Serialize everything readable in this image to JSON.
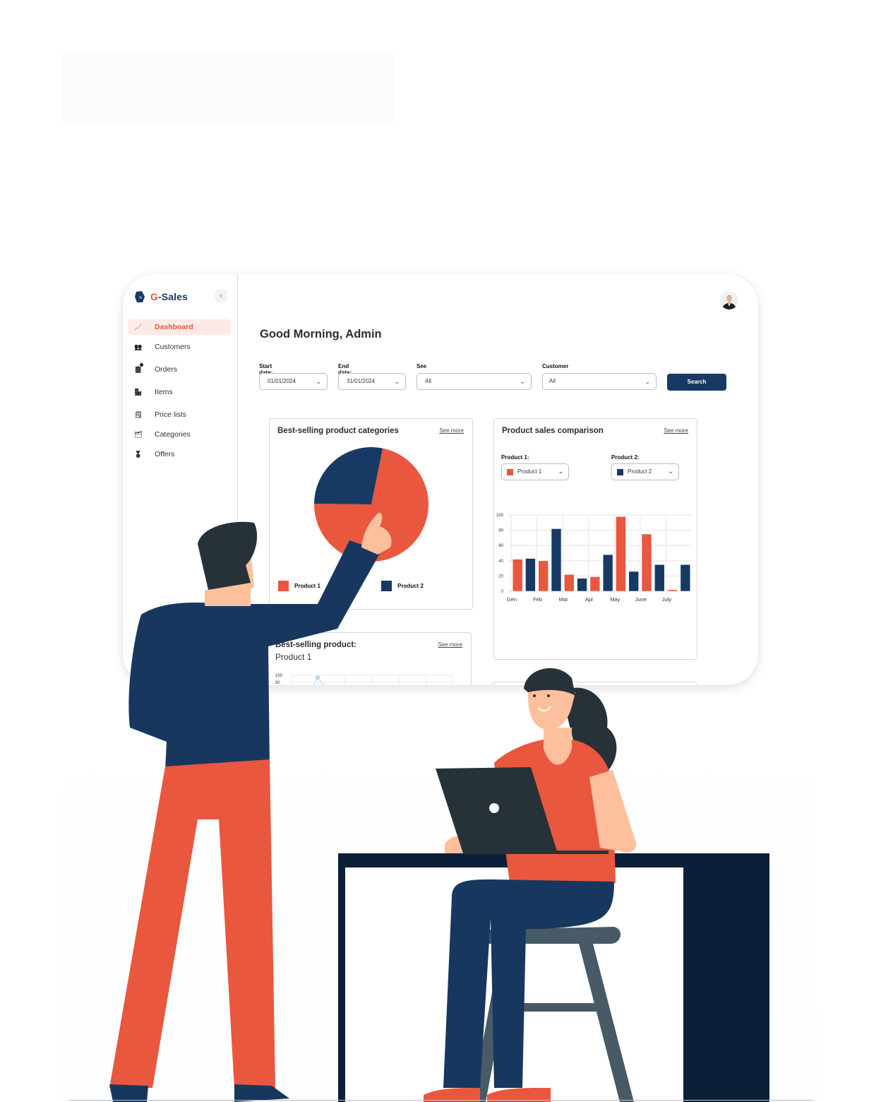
{
  "app": {
    "brand_prefix": "G",
    "brand_suffix": "-Sales",
    "collapse_icon": "chevron-left-icon",
    "collapse_glyph": "‹"
  },
  "sidebar": {
    "items": [
      {
        "label": "Dashboard",
        "icon": "chart-line-icon",
        "glyph": "📈",
        "active": true
      },
      {
        "label": "Customers",
        "icon": "users-icon",
        "glyph": "👥",
        "active": false
      },
      {
        "label": "Orders",
        "icon": "clipboard-icon",
        "glyph": "📋",
        "active": false,
        "notification": true
      },
      {
        "label": "Items",
        "icon": "store-icon",
        "glyph": "🏪",
        "active": false
      },
      {
        "label": "Price lists",
        "icon": "price-list-icon",
        "glyph": "🗒",
        "active": false
      },
      {
        "label": "Categories",
        "icon": "categories-icon",
        "glyph": "🗂",
        "active": false
      },
      {
        "label": "Offers",
        "icon": "award-icon",
        "glyph": "🏅",
        "active": false
      }
    ]
  },
  "header": {
    "greeting": "Good Morning, Admin",
    "avatar": "user-avatar"
  },
  "filters": {
    "start_date": {
      "label": "Start date:",
      "value": "01/01/2024"
    },
    "end_date": {
      "label": "End date:",
      "value": "31/01/2024"
    },
    "see": {
      "label": "See",
      "value": "All"
    },
    "customer": {
      "label": "Customer",
      "value": "All"
    },
    "search_label": "Search",
    "chevron": "⌄"
  },
  "cards": {
    "categories": {
      "title": "Best-selling product categories",
      "see_more": "See more"
    },
    "comparison": {
      "title": "Product sales comparison",
      "see_more": "See more",
      "product1_label": "Product 1:",
      "product1_value": "Product 1",
      "product2_label": "Product 2:",
      "product2_value": "Product 2"
    },
    "best_product": {
      "title": "Best-selling product:",
      "subtitle": "Product 1",
      "see_more": "See more"
    }
  },
  "colors": {
    "product1": "#e9573f",
    "product2": "#173a64",
    "accent": "#e9573f",
    "primary": "#173a64"
  },
  "chart_data": [
    {
      "type": "pie",
      "title": "Best-selling product categories",
      "labels": [
        "Product 1",
        "Product 2"
      ],
      "values": [
        72,
        28
      ],
      "legend": "bottom"
    },
    {
      "type": "bar",
      "title": "Product sales comparison",
      "categories": [
        "Gen",
        "Feb",
        "Mar",
        "Apr",
        "May",
        "June",
        "July"
      ],
      "series": [
        {
          "name": "Product 1",
          "values": [
            42,
            40,
            22,
            19,
            98,
            75,
            2
          ]
        },
        {
          "name": "Product 2",
          "values": [
            43,
            82,
            17,
            48,
            26,
            35,
            35
          ]
        }
      ],
      "ylim": [
        0,
        100
      ],
      "yticks": [
        0,
        20,
        40,
        60,
        80,
        100
      ],
      "grid": true,
      "xlabel": "",
      "ylabel": ""
    },
    {
      "type": "line",
      "title": "Best-selling product: Product 1",
      "yticks_visible": [
        100,
        90
      ],
      "note": "partially visible, cut off by window edge"
    }
  ]
}
